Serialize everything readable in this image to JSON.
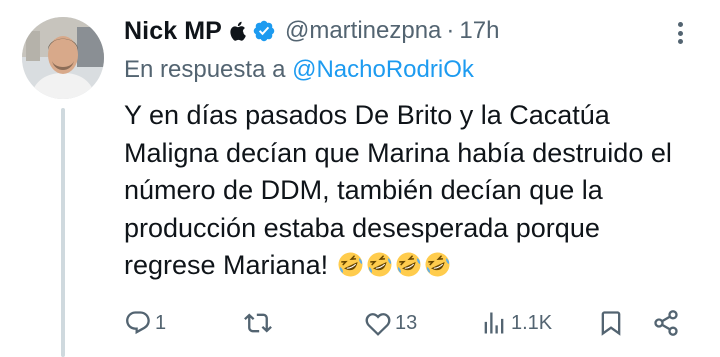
{
  "tweet": {
    "author_name": "Nick MP",
    "handle": "@martinezpna",
    "separator": "·",
    "time": "17h",
    "reply_prefix": "En respuesta a",
    "reply_to": "@NachoRodriOk",
    "text_lines": [
      "Y en días pasados De Brito y la Cacatúa",
      "Maligna decían que Marina había destruido el",
      "número de DDM, también decían que la",
      "producción estaba desesperada porque",
      "regrese Mariana!"
    ],
    "emojis": [
      "rolling-on-floor-laughing",
      "rolling-on-floor-laughing",
      "rolling-on-floor-laughing",
      "rolling-on-floor-laughing"
    ]
  },
  "actions": {
    "replies": "1",
    "retweets": "",
    "likes": "13",
    "views": "1.1K"
  },
  "colors": {
    "text_primary": "#0f1419",
    "text_secondary": "#536471",
    "link": "#1d9bf0",
    "verified": "#1d9bf0",
    "thread_line": "#cfd9de"
  },
  "icons": [
    "apple-icon",
    "verified-badge-icon",
    "more-icon",
    "reply-icon",
    "retweet-icon",
    "like-icon",
    "views-icon",
    "bookmark-icon",
    "share-icon"
  ]
}
